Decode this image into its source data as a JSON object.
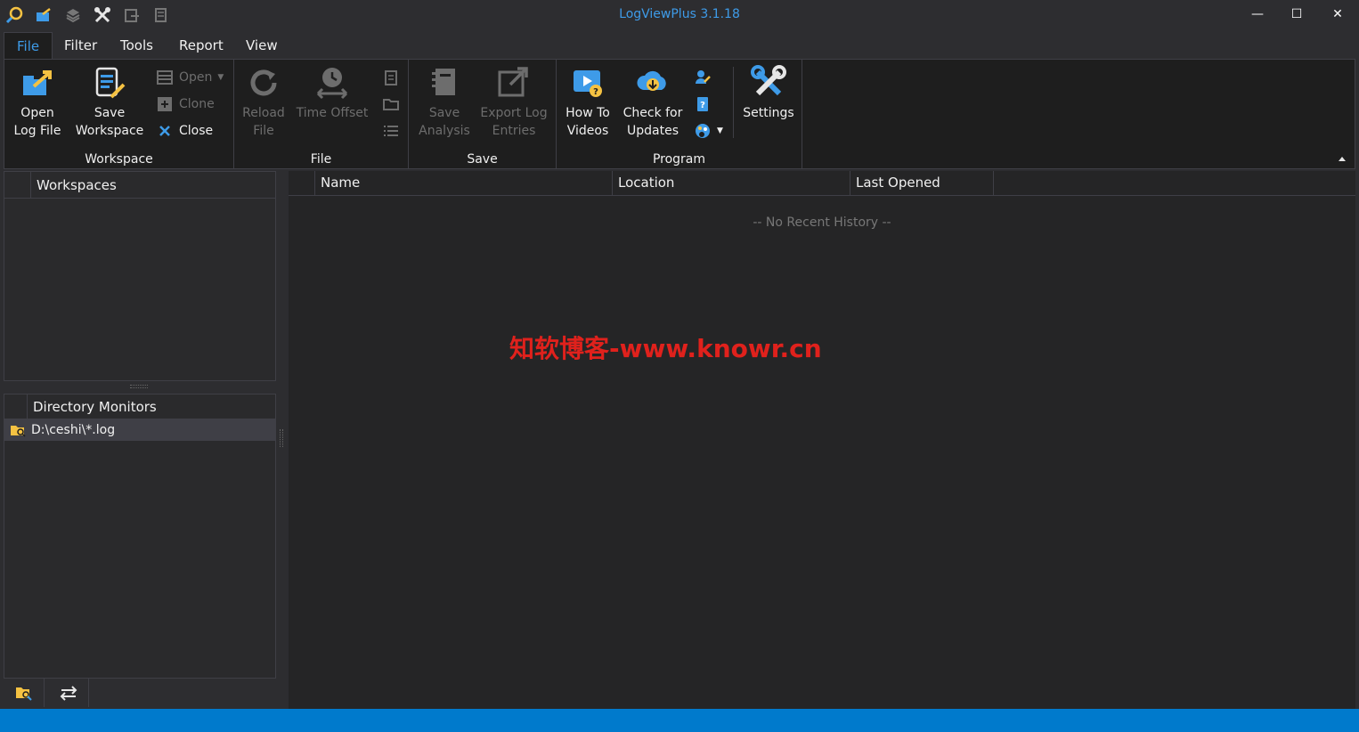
{
  "window": {
    "title": "LogViewPlus 3.1.18",
    "minimize": "—",
    "maximize": "☐",
    "close": "✕"
  },
  "quick_access": [
    {
      "icon": "search-log-icon"
    },
    {
      "icon": "open-file-icon"
    },
    {
      "icon": "layers-icon"
    },
    {
      "icon": "tools-icon"
    },
    {
      "icon": "export-icon"
    },
    {
      "icon": "report-icon"
    }
  ],
  "menu": {
    "tabs": [
      "File",
      "Filter",
      "Tools",
      "Report",
      "View"
    ],
    "active": "File"
  },
  "ribbon": {
    "groups": {
      "workspace": {
        "label": "Workspace",
        "open_log_file": "Open\nLog File",
        "save_workspace": "Save\nWorkspace",
        "open": "Open",
        "clone": "Clone",
        "close": "Close"
      },
      "file": {
        "label": "File",
        "reload_file": "Reload\nFile",
        "time_offset": "Time Offset"
      },
      "save": {
        "label": "Save",
        "save_analysis": "Save\nAnalysis",
        "export_log_entries": "Export Log\nEntries"
      },
      "program": {
        "label": "Program",
        "how_to_videos": "How To\nVideos",
        "check_for_updates": "Check for\nUpdates",
        "settings": "Settings"
      }
    }
  },
  "workspaces_panel": {
    "header": "Workspaces"
  },
  "directory_monitors_panel": {
    "header": "Directory Monitors",
    "items": [
      "D:\\ceshi\\*.log"
    ]
  },
  "recent_table": {
    "columns": [
      "Name",
      "Location",
      "Last Opened"
    ],
    "empty_message": "--  No Recent History  --"
  },
  "watermark": "知软博客-www.knowr.cn",
  "colors": {
    "accent": "#3e9be8",
    "status_bar": "#007acc",
    "folder_yellow": "#f5c242",
    "watermark": "#e0211c"
  }
}
